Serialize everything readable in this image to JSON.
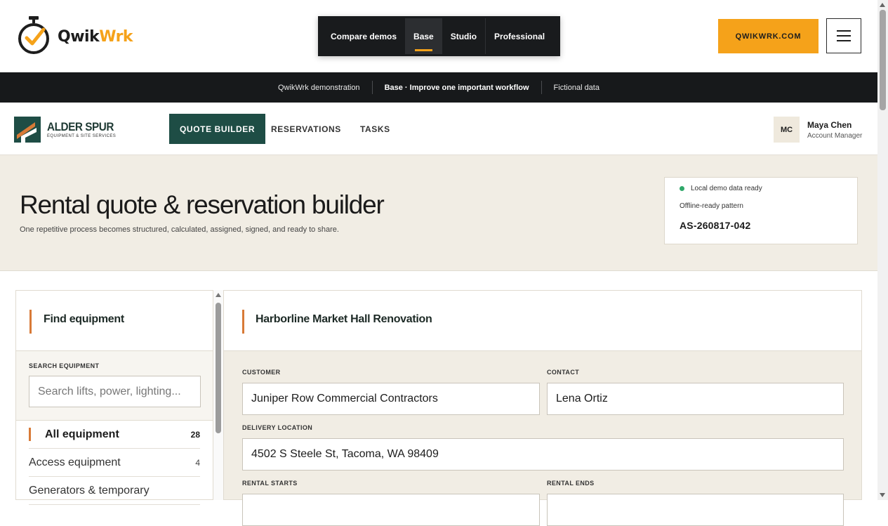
{
  "site": {
    "logo_q": "Qwik",
    "logo_w": "Wrk",
    "demos": [
      {
        "label": "Compare demos"
      },
      {
        "label": "Base",
        "active": true
      },
      {
        "label": "Studio"
      },
      {
        "label": "Professional"
      }
    ],
    "site_button": "QWIKWRK.COM",
    "menu_icon": "hamburger-icon"
  },
  "strip": {
    "left": "QwikWrk demonstration",
    "middle": "Base · Improve one important workflow",
    "right": "Fictional data"
  },
  "app": {
    "brand_name": "ALDER SPUR",
    "brand_sub": "EQUIPMENT & SITE SERVICES",
    "tabs": [
      {
        "label": "QUOTE BUILDER",
        "active": true
      },
      {
        "label": "RESERVATIONS"
      },
      {
        "label": "TASKS"
      }
    ],
    "user": {
      "initials": "MC",
      "name": "Maya Chen",
      "role": "Account Manager"
    }
  },
  "hero": {
    "title": "Rental quote & reservation builder",
    "subtitle": "One repetitive process becomes structured, calculated, assigned, signed, and ready to share.",
    "status": "Local demo data ready",
    "status_color": "#2fa86a",
    "pattern": "Offline-ready pattern",
    "quote_id": "AS-260817-042"
  },
  "sidebar": {
    "title": "Find equipment",
    "search_label": "SEARCH EQUIPMENT",
    "search_placeholder": "Search lifts, power, lighting...",
    "categories": [
      {
        "label": "All equipment",
        "count": "28",
        "active": true
      },
      {
        "label": "Access equipment",
        "count": "4"
      },
      {
        "label": "Generators & temporary",
        "count": ""
      }
    ]
  },
  "quote": {
    "project": "Harborline Market Hall Renovation",
    "customer_label": "CUSTOMER",
    "customer": "Juniper Row Commercial Contractors",
    "contact_label": "CONTACT",
    "contact": "Lena Ortiz",
    "delivery_label": "DELIVERY LOCATION",
    "delivery": "4502 S Steele St, Tacoma, WA 98409",
    "starts_label": "RENTAL STARTS",
    "ends_label": "RENTAL ENDS"
  },
  "colors": {
    "accent_orange": "#f5a21a",
    "brand_green": "#1e4d45",
    "accent_rust": "#d87a37"
  }
}
